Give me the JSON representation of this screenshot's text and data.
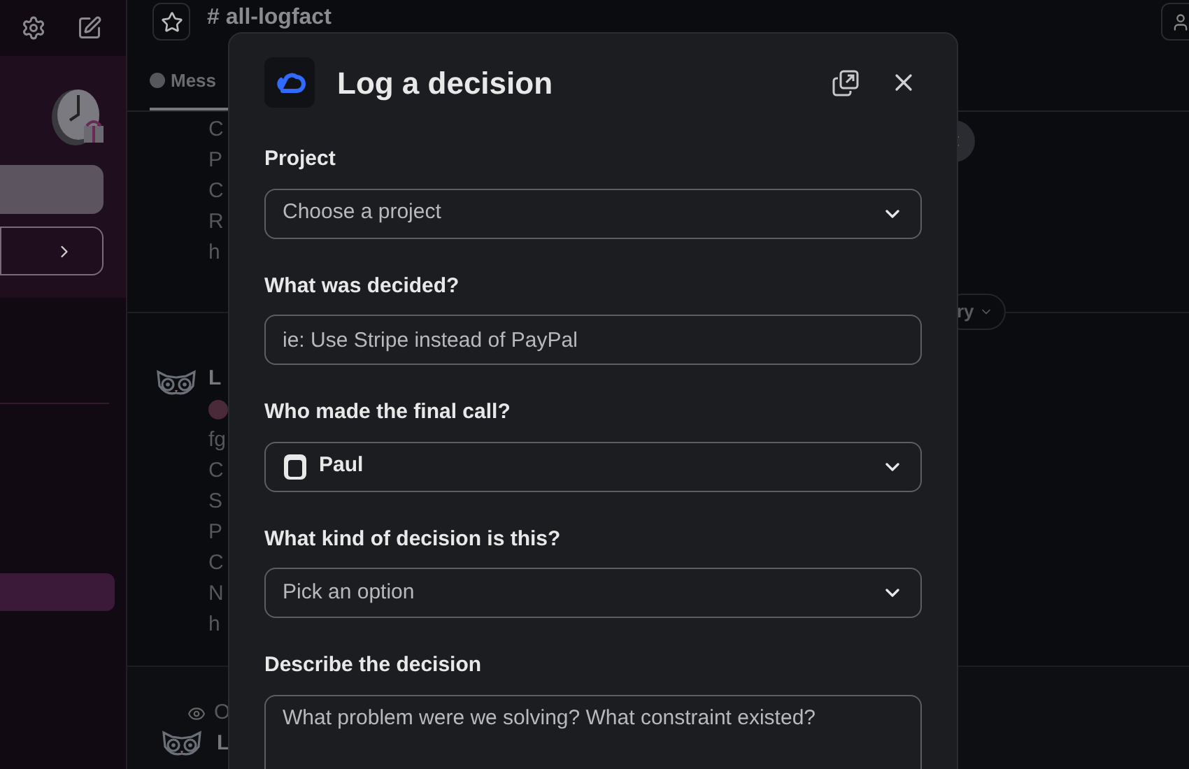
{
  "channel": {
    "name": "# all-logfact",
    "tab": "Mess",
    "pill": "ry"
  },
  "message_groups": [
    {
      "lines": [
        "C",
        "P",
        "C",
        "R",
        "h"
      ]
    },
    {
      "author": "L",
      "lines": [
        "fg",
        "C",
        "S",
        "P",
        "C",
        "N",
        "h"
      ]
    },
    {
      "author": "L",
      "context": "O"
    }
  ],
  "modal": {
    "title": "Log a decision",
    "fields": [
      {
        "kind": "select",
        "label": "Project",
        "placeholder": "Choose a project"
      },
      {
        "kind": "input",
        "label": "What was decided?",
        "placeholder": "ie: Use Stripe instead of PayPal"
      },
      {
        "kind": "select",
        "label": "Who made the final call?",
        "value": "Paul"
      },
      {
        "kind": "select",
        "label": "What kind of decision is this?",
        "placeholder": "Pick an option"
      },
      {
        "kind": "textarea",
        "label": "Describe the decision",
        "placeholder": "What problem were we solving? What constraint existed?"
      }
    ]
  }
}
